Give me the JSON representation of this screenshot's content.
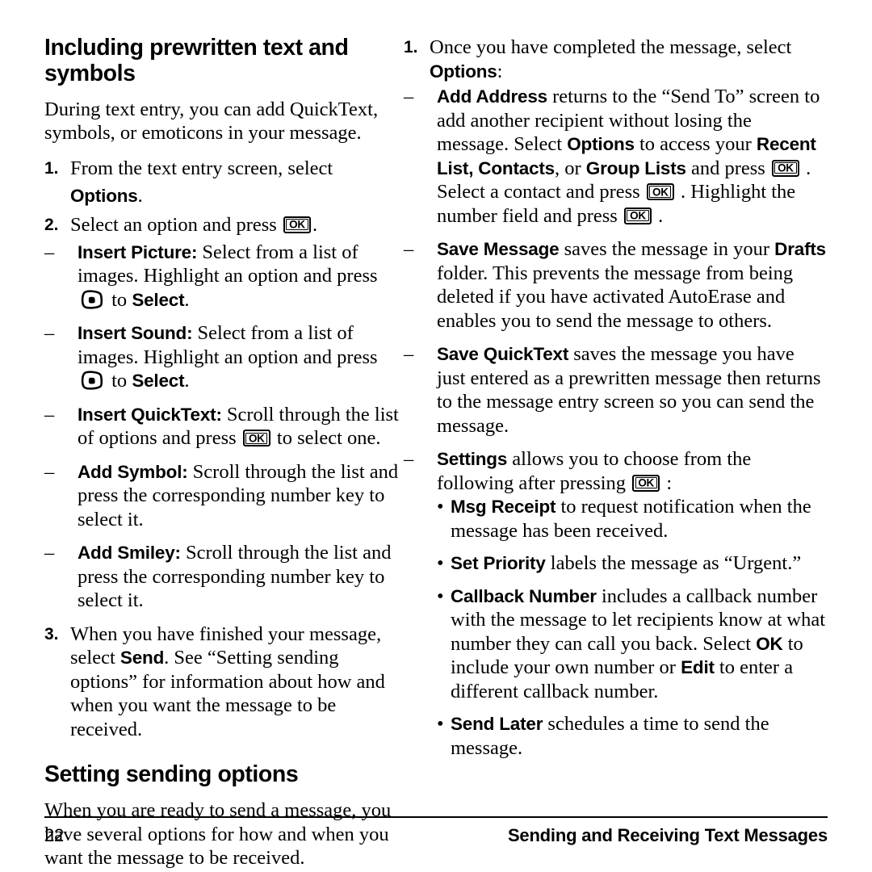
{
  "document": {
    "footer": {
      "page_number": "22",
      "running_title": "Sending and Receiving Text Messages"
    }
  },
  "left_column": {
    "heading_1": "Including prewritten text and symbols",
    "intro_paragraph": "During text entry, you can add QuickText, symbols, or emoticons in your message.",
    "steps": [
      {
        "marker": "1.",
        "text_before": "From the text entry screen, select ",
        "term": "Options",
        "text_after": "."
      },
      {
        "marker": "2.",
        "text_before": "Select an option and press ",
        "key": "OK",
        "text_after": "."
      }
    ],
    "sub_items": [
      {
        "marker": "–",
        "term": "Insert Picture:",
        "text_1": " Select from a list of images. Highlight an option and press ",
        "key": "soft-key",
        "text_2": " to ",
        "term_2": "Select",
        "text_3": "."
      },
      {
        "marker": "–",
        "term": "Insert Sound:",
        "text_1": " Select from a list of images. Highlight an option and press ",
        "key": "soft-key",
        "text_2": " to ",
        "term_2": "Select",
        "text_3": "."
      },
      {
        "marker": "–",
        "term": "Insert QuickText:",
        "text_1": " Scroll through the list of options and press ",
        "key": "OK",
        "text_2": " to select one."
      },
      {
        "marker": "–",
        "term": "Add Symbol:",
        "text_1": " Scroll through the list and press the corresponding number key to select it."
      },
      {
        "marker": "–",
        "term": "Add Smiley:",
        "text_1": " Scroll through the list and press the corresponding number key to select it."
      }
    ],
    "step_3": {
      "marker": "3.",
      "text_before": "When you have finished your message, select ",
      "term": "Send",
      "text_after": ". See “Setting sending options” for information about how and when you want the message to be received."
    },
    "heading_2": "Setting sending options",
    "closing_paragraph": "When you are ready to send a message, you have several options for how and when you want the message to be received."
  },
  "right_column": {
    "step_1": {
      "marker": "1.",
      "text_before": "Once you have completed the message, select ",
      "term": "Options",
      "text_after": ":"
    },
    "items": [
      {
        "marker": "–",
        "term": "Add Address",
        "seg_1": " returns to the “Send To” screen to add another recipient without losing the message. Select ",
        "term_2": "Options",
        "seg_2": " to access your ",
        "term_3": "Recent List, Contacts",
        "seg_3": ", or ",
        "term_4": "Group Lists",
        "seg_4": " and press ",
        "key_1": "OK",
        "seg_5": " . Select a contact and press ",
        "key_2": "OK",
        "seg_6": " . Highlight the number field and press ",
        "key_3": "OK",
        "seg_7": " ."
      },
      {
        "marker": "–",
        "term": "Save Message",
        "seg_1": " saves the message in your ",
        "term_2": "Drafts",
        "seg_2": " folder. This prevents the message from being deleted if you have activated AutoErase and enables you to send the message to others."
      },
      {
        "marker": "–",
        "term": "Save QuickText",
        "seg_1": " saves the message you have just entered as a prewritten message then returns to the message entry screen so you can send the message."
      }
    ],
    "settings_item": {
      "marker": "–",
      "term": "Settings",
      "seg_1": " allows you to choose from the following after pressing ",
      "key": "OK",
      "seg_2": " :"
    },
    "settings_bullets": [
      {
        "marker": "•",
        "term": "Msg Receipt",
        "seg_1": " to request notification when the message has been received."
      },
      {
        "marker": "•",
        "term": "Set Priority",
        "seg_1": " labels the message as “Urgent.”"
      },
      {
        "marker": "•",
        "term": "Callback Number",
        "seg_1": " includes a callback number with the message to let recipients know at what number they can call you back. Select ",
        "term_2": "OK",
        "seg_2": " to include your own number or ",
        "term_3": "Edit",
        "seg_3": " to enter a different callback number."
      },
      {
        "marker": "•",
        "term": "Send Later",
        "seg_1": " schedules a time to send the message."
      }
    ]
  }
}
